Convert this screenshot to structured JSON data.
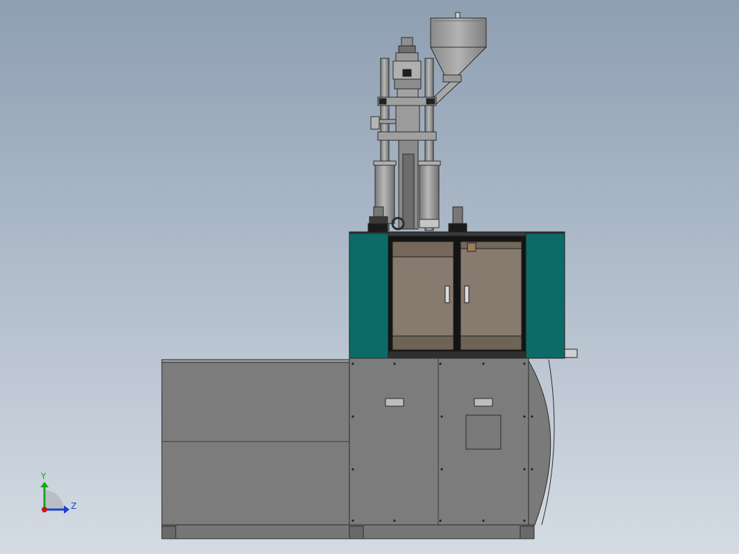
{
  "viewport": {
    "background_top": "#8e9fb2",
    "background_bottom": "#d4dbe4"
  },
  "colors": {
    "cabinet_gray": "#7c7c7c",
    "cabinet_dark": "#5d5d5d",
    "outline": "#2a2a2a",
    "guard_teal": "#0c6b66",
    "window_brown": "#877a6e",
    "metal_light": "#a9a9a9",
    "metal_mid": "#8f8f8f",
    "hopper": "#9c9c9c",
    "y_axis": "#1aa31a",
    "z_axis": "#1d3fcf",
    "origin": "#c21818"
  },
  "triad": {
    "y_label": "Y",
    "z_label": "Z"
  }
}
